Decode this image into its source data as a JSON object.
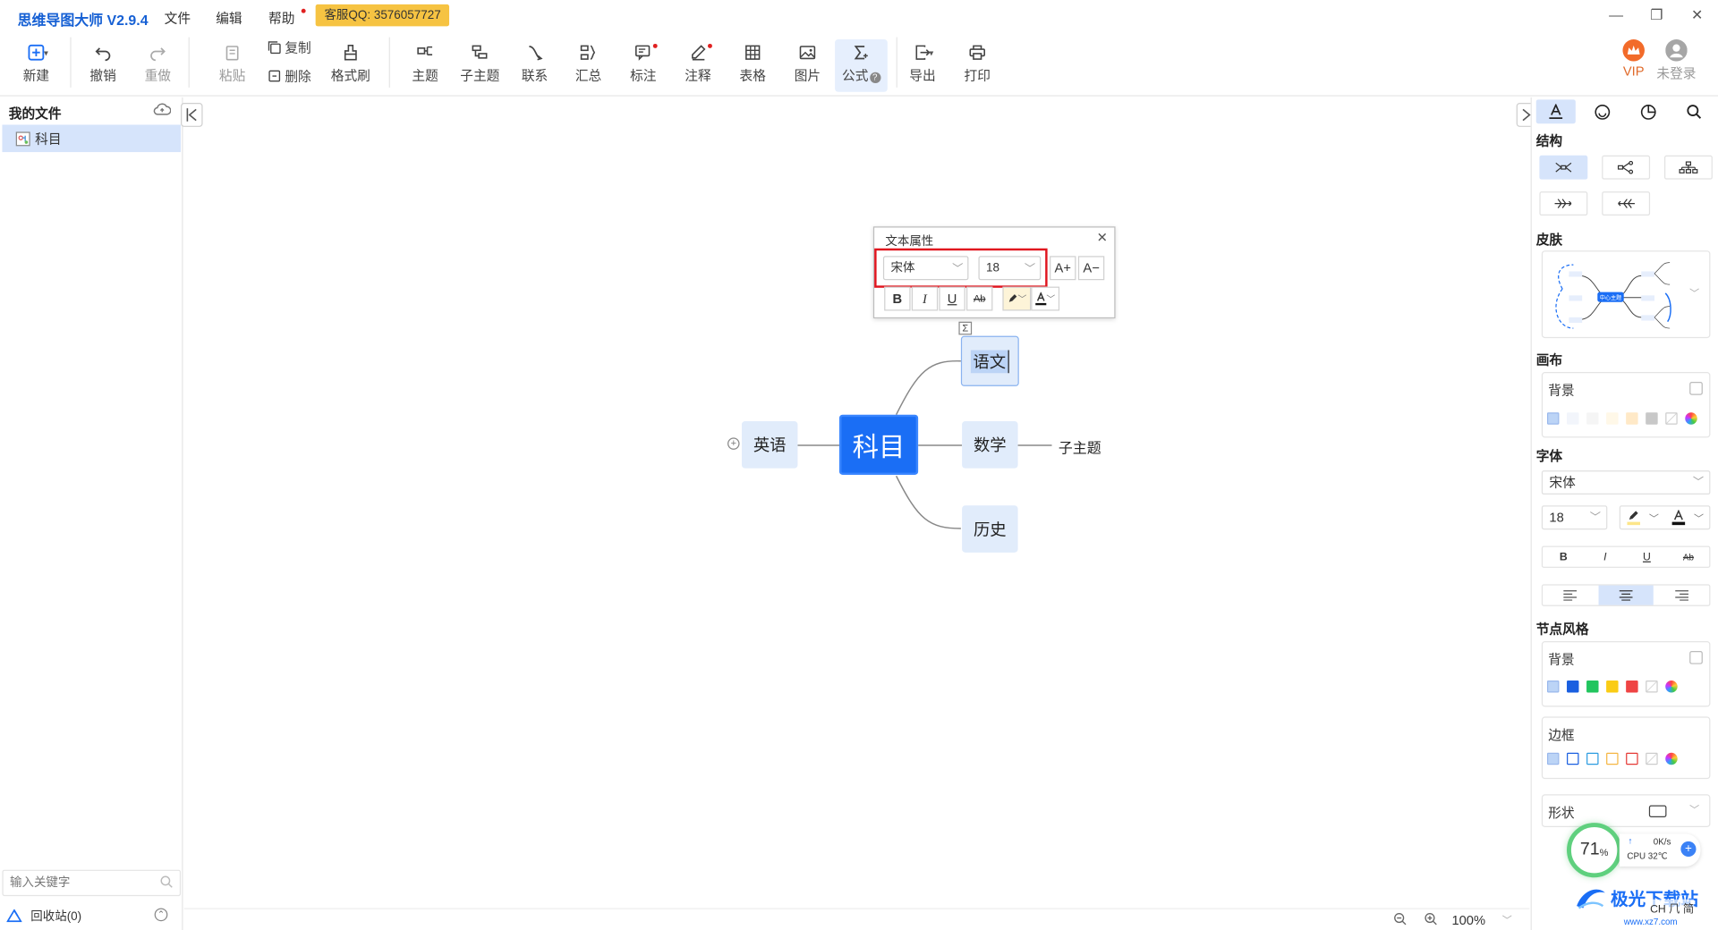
{
  "app": {
    "title": "思维导图大师 V2.9.4",
    "menus": [
      "文件",
      "编辑",
      "帮助"
    ],
    "service_qq": "客服QQ: 3576057727"
  },
  "toolbar": {
    "new": "新建",
    "undo": "撤销",
    "redo": "重做",
    "paste": "粘贴",
    "copy": "复制",
    "delete": "删除",
    "format_brush": "格式刷",
    "topic": "主题",
    "subtopic": "子主题",
    "relation": "联系",
    "summary": "汇总",
    "mark": "标注",
    "note": "注释",
    "table": "表格",
    "image": "图片",
    "formula": "公式",
    "export": "导出",
    "print": "打印",
    "vip": "VIP",
    "login": "未登录"
  },
  "left_panel": {
    "title": "我的文件",
    "files": [
      "科目"
    ],
    "search_placeholder": "输入关键字",
    "recycle": "回收站(0)"
  },
  "mindmap": {
    "center": "科目",
    "nodes": [
      "语文",
      "数学",
      "历史",
      "英语"
    ],
    "subtopic": "子主题"
  },
  "text_props": {
    "title": "文本属性",
    "font": "宋体",
    "size": "18",
    "bold": "B",
    "italic": "I",
    "underline": "U",
    "strike": "Ab",
    "grow": "A+",
    "shrink": "A−"
  },
  "right_panel": {
    "structure": "结构",
    "skin": "皮肤",
    "canvas": "画布",
    "background": "背景",
    "font": "字体",
    "font_name": "宋体",
    "font_size": "18",
    "bold": "B",
    "italic": "I",
    "underline": "U",
    "strike": "Ab",
    "node_style": "节点风格",
    "node_bg": "背景",
    "border": "边框",
    "shape": "形状",
    "skin_center": "中心主题",
    "canvas_colors": [
      "#f2f5fb",
      "#f5f5f5",
      "#fff8e8",
      "#ffe9c7",
      "#c8c8c8"
    ],
    "node_colors": [
      "#1a5fe0",
      "#22c55e",
      "#facc15",
      "#ef4444"
    ],
    "border_colors": [
      "#1a5fe0",
      "#2c9ce0",
      "#f5b642",
      "#e53935"
    ]
  },
  "status": {
    "zoom": "100%",
    "cpu_percent": "71",
    "cpu_unit": "%",
    "net": "0K/s",
    "cpu_temp": "CPU 32℃",
    "ime": "CH ⺇ 简",
    "watermark": "极光下载站",
    "watermark_url": "www.xz7.com"
  }
}
